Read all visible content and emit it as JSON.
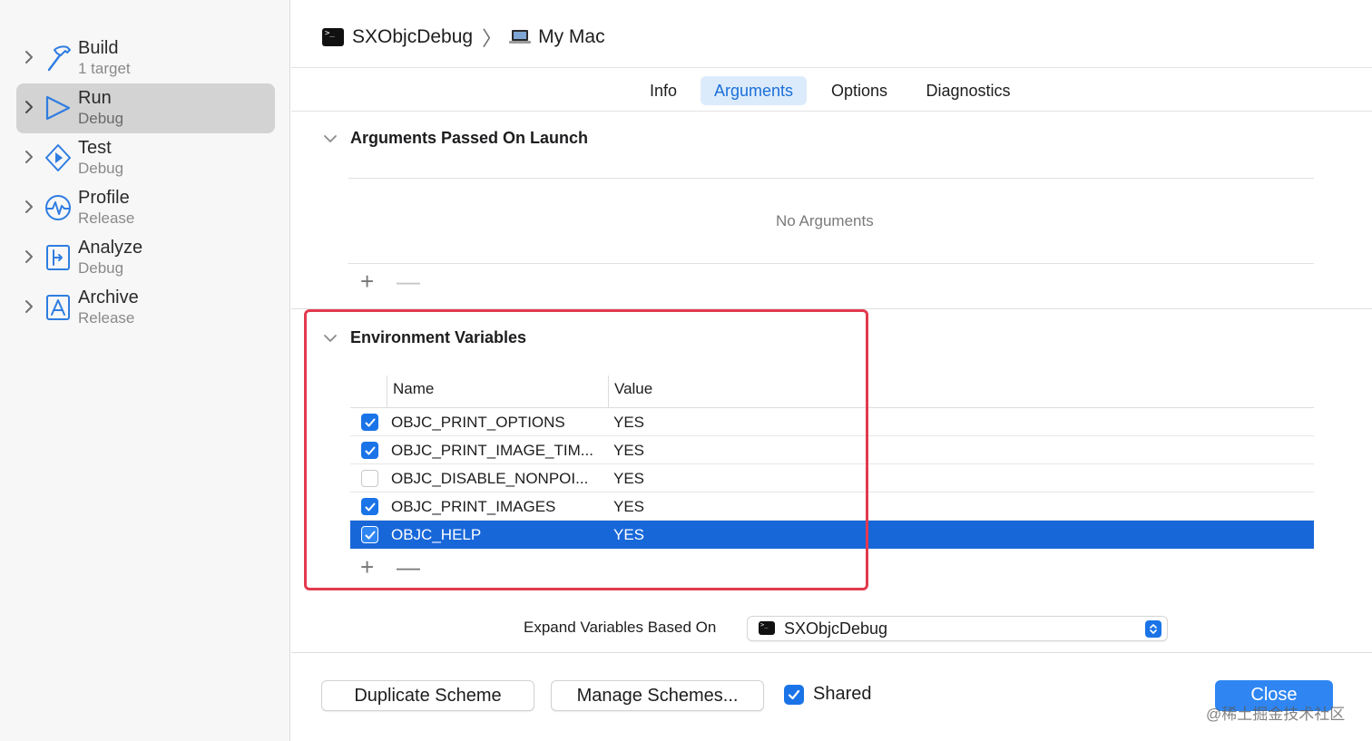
{
  "sidebar": {
    "items": [
      {
        "title": "Build",
        "subtitle": "1 target",
        "icon": "hammer-icon"
      },
      {
        "title": "Run",
        "subtitle": "Debug",
        "icon": "play-icon",
        "selected": true
      },
      {
        "title": "Test",
        "subtitle": "Debug",
        "icon": "test-diamond-icon"
      },
      {
        "title": "Profile",
        "subtitle": "Release",
        "icon": "waveform-icon"
      },
      {
        "title": "Analyze",
        "subtitle": "Debug",
        "icon": "analyze-icon"
      },
      {
        "title": "Archive",
        "subtitle": "Release",
        "icon": "archive-icon"
      }
    ]
  },
  "header": {
    "scheme": "SXObjcDebug",
    "destination": "My Mac"
  },
  "tabs": [
    {
      "label": "Info"
    },
    {
      "label": "Arguments",
      "active": true
    },
    {
      "label": "Options"
    },
    {
      "label": "Diagnostics"
    }
  ],
  "arguments_section": {
    "title": "Arguments Passed On Launch",
    "empty_text": "No Arguments",
    "add_label": "+",
    "remove_label": "—"
  },
  "env_section": {
    "title": "Environment Variables",
    "columns": {
      "name": "Name",
      "value": "Value"
    },
    "rows": [
      {
        "name": "OBJC_PRINT_OPTIONS",
        "value": "YES",
        "checked": true
      },
      {
        "name": "OBJC_PRINT_IMAGE_TIM...",
        "value": "YES",
        "checked": true
      },
      {
        "name": "OBJC_DISABLE_NONPOI...",
        "value": "YES",
        "checked": false
      },
      {
        "name": "OBJC_PRINT_IMAGES",
        "value": "YES",
        "checked": true
      },
      {
        "name": "OBJC_HELP",
        "value": "YES",
        "checked": true,
        "selected": true
      }
    ],
    "add_label": "+",
    "remove_label": "—"
  },
  "expand": {
    "label": "Expand Variables Based On",
    "value": "SXObjcDebug"
  },
  "footer": {
    "duplicate_label": "Duplicate Scheme",
    "manage_label": "Manage Schemes...",
    "shared_label": "Shared",
    "shared_checked": true,
    "close_label": "Close"
  },
  "watermark": "@稀土掘金技术社区",
  "colors": {
    "accent": "#1a74e8",
    "selection": "#1867d9",
    "highlight_border": "#e33a4e"
  }
}
